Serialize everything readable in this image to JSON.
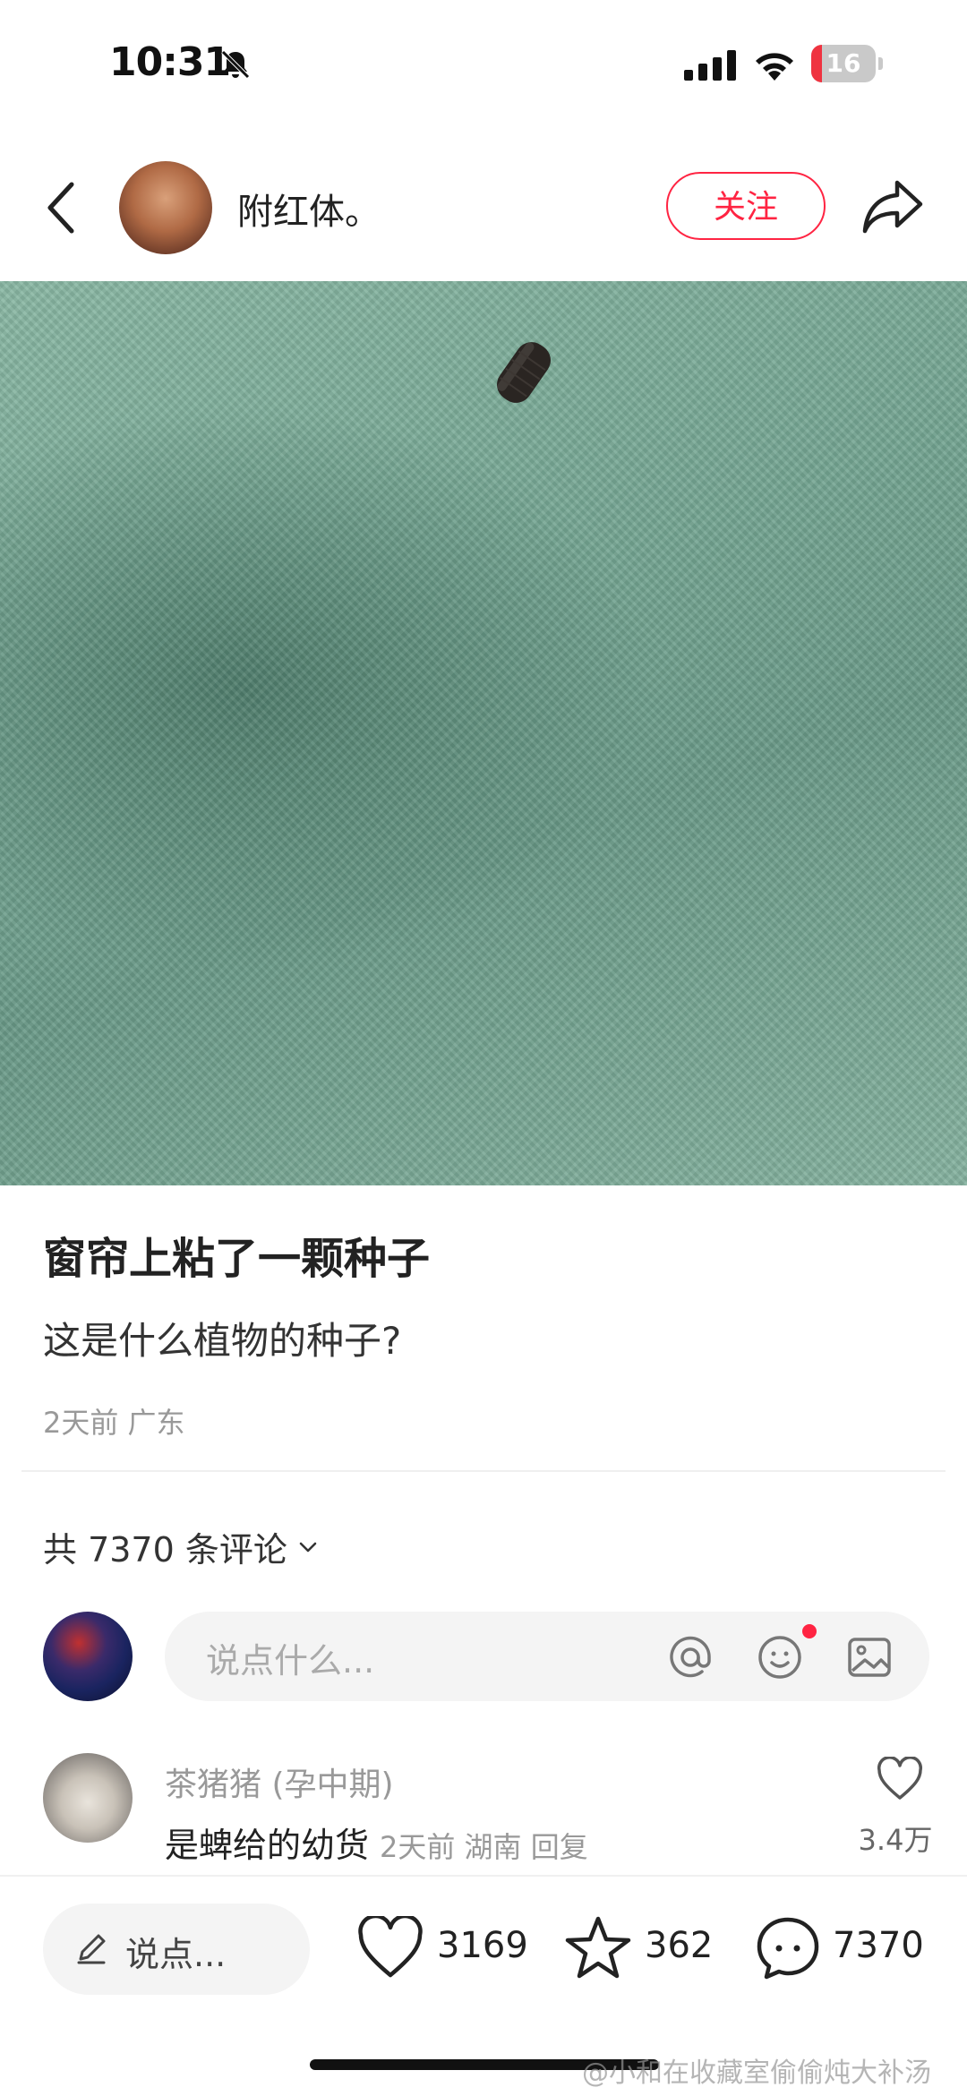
{
  "status": {
    "time": "10:31",
    "battery": "16",
    "battery_level": 0.16
  },
  "header": {
    "author": "附红体。",
    "follow_label": "关注"
  },
  "post": {
    "title": "窗帘上粘了一颗种子",
    "body": "这是什么植物的种子?",
    "meta": "2天前 广东"
  },
  "comments": {
    "count_label": "共 7370 条评论",
    "input_placeholder": "说点什么...",
    "items": [
      {
        "user": "茶猪猪 (孕中期)",
        "text": "是蜱给的幼货",
        "meta": "2天前 湖南 回复",
        "likes": "3.4万"
      }
    ]
  },
  "bottom": {
    "say_label": "说点...",
    "likes": "3169",
    "stars": "362",
    "comments": "7370"
  },
  "watermark": "@小和在收藏室偷偷炖大补汤",
  "colors": {
    "accent": "#ff2442",
    "battery_fill": "#ef3340"
  },
  "icons": [
    "bell-slash-icon",
    "signal-icon",
    "wifi-icon",
    "battery-icon",
    "back-icon",
    "share-icon",
    "mute-icon",
    "chevron-down-icon",
    "at-icon",
    "emoji-icon",
    "image-icon",
    "heart-icon",
    "pen-icon",
    "star-icon",
    "chat-icon"
  ]
}
